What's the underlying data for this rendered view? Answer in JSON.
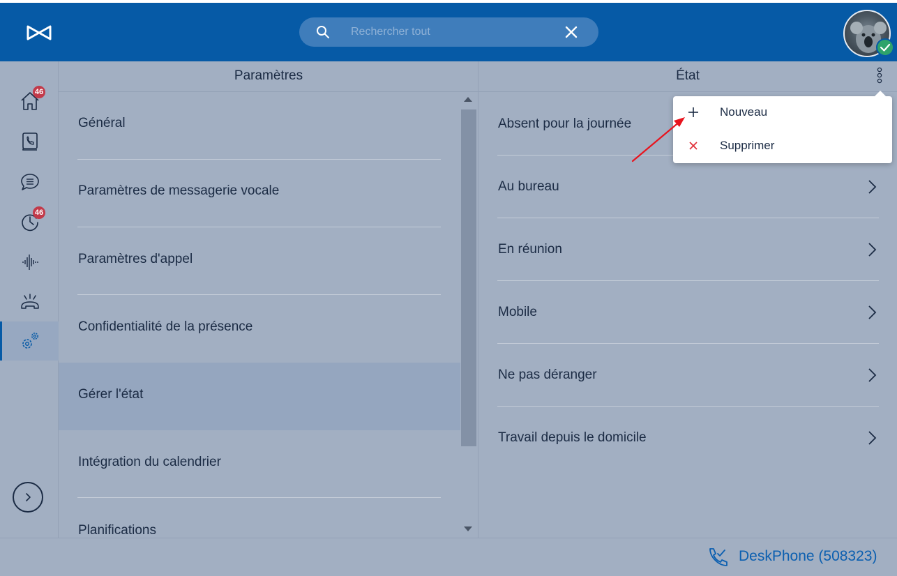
{
  "colors": {
    "brand_blue": "#065aa6",
    "background": "#a2afc2",
    "active_row": "#95a6bf",
    "badge_red": "#c23a4a",
    "link_blue": "#0b5fb0",
    "delete_red": "#e0313a",
    "annotation_arrow": "#e8141e",
    "status_green": "#2ea36b"
  },
  "header": {
    "logo_icon": "brand-logo-icon",
    "search": {
      "placeholder": "Rechercher tout",
      "value": "",
      "search_icon": "search-icon",
      "clear_icon": "close-icon"
    },
    "avatar_icon": "user-avatar",
    "presence_icon": "checkmark-icon"
  },
  "sidebar": {
    "items": [
      {
        "icon": "home-icon",
        "badge": "46",
        "active": false
      },
      {
        "icon": "phonebook-icon",
        "badge": "",
        "active": false
      },
      {
        "icon": "chat-icon",
        "badge": "",
        "active": false
      },
      {
        "icon": "history-icon",
        "badge": "46",
        "active": false
      },
      {
        "icon": "voicemail-waveform-icon",
        "badge": "",
        "active": false
      },
      {
        "icon": "ringing-phone-icon",
        "badge": "",
        "active": false
      },
      {
        "icon": "settings-gears-icon",
        "badge": "",
        "active": true
      }
    ],
    "expand_icon": "chevron-right-icon"
  },
  "settings": {
    "title": "Paramètres",
    "items": [
      {
        "label": "Général",
        "active": false
      },
      {
        "label": "Paramètres de messagerie vocale",
        "active": false
      },
      {
        "label": "Paramètres d'appel",
        "active": false
      },
      {
        "label": "Confidentialité de la présence",
        "active": false
      },
      {
        "label": "Gérer l'état",
        "active": true
      },
      {
        "label": "Intégration du calendrier",
        "active": false
      },
      {
        "label": "Planifications",
        "active": false
      }
    ]
  },
  "status": {
    "title": "État",
    "more_icon": "more-vertical-icon",
    "items": [
      {
        "label": "Absent pour la journée"
      },
      {
        "label": "Au bureau"
      },
      {
        "label": "En réunion"
      },
      {
        "label": "Mobile"
      },
      {
        "label": "Ne pas déranger"
      },
      {
        "label": "Travail depuis le domicile"
      }
    ]
  },
  "menu": {
    "items": [
      {
        "label": "Nouveau",
        "icon": "plus-icon"
      },
      {
        "label": "Supprimer",
        "icon": "close-icon"
      }
    ]
  },
  "footer": {
    "phone_icon": "deskphone-icon",
    "label": "DeskPhone (508323)"
  }
}
